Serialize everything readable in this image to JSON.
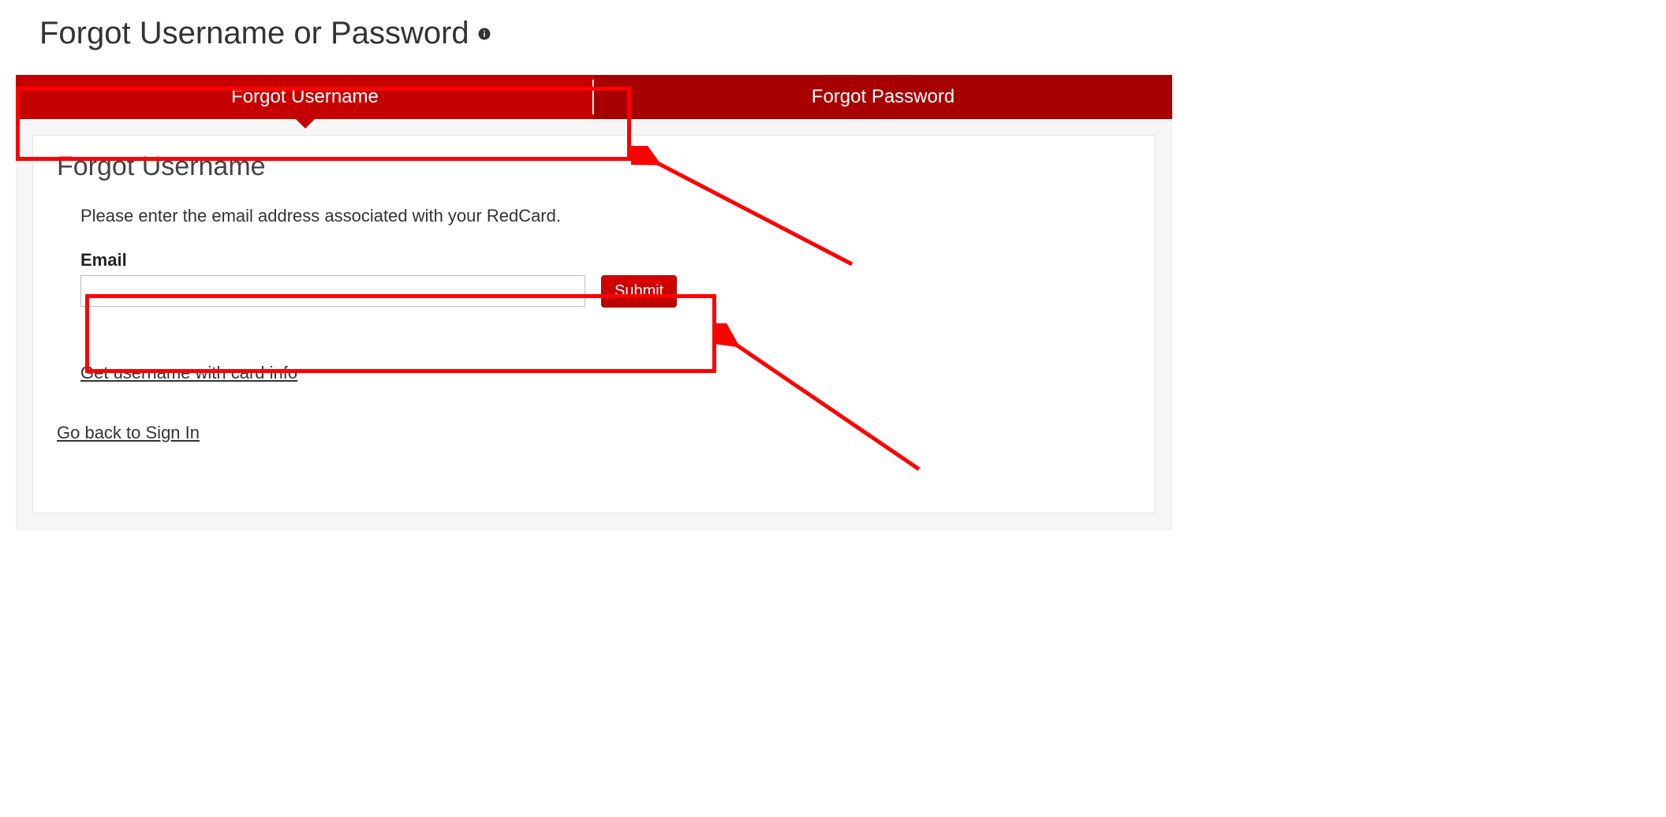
{
  "header": {
    "title": "Forgot Username or Password"
  },
  "tabs": {
    "forgot_username": "Forgot Username",
    "forgot_password": "Forgot Password"
  },
  "panel": {
    "heading": "Forgot Username",
    "instruction": "Please enter the email address associated with your RedCard.",
    "email_label": "Email",
    "email_value": "",
    "submit_label": "Submit",
    "alt_link": "Get username with card info",
    "back_link": "Go back to Sign In"
  },
  "colors": {
    "tab_active": "#c40000",
    "tab_inactive": "#a70000",
    "accent": "#cc0000",
    "annotation": "#ff0000"
  }
}
